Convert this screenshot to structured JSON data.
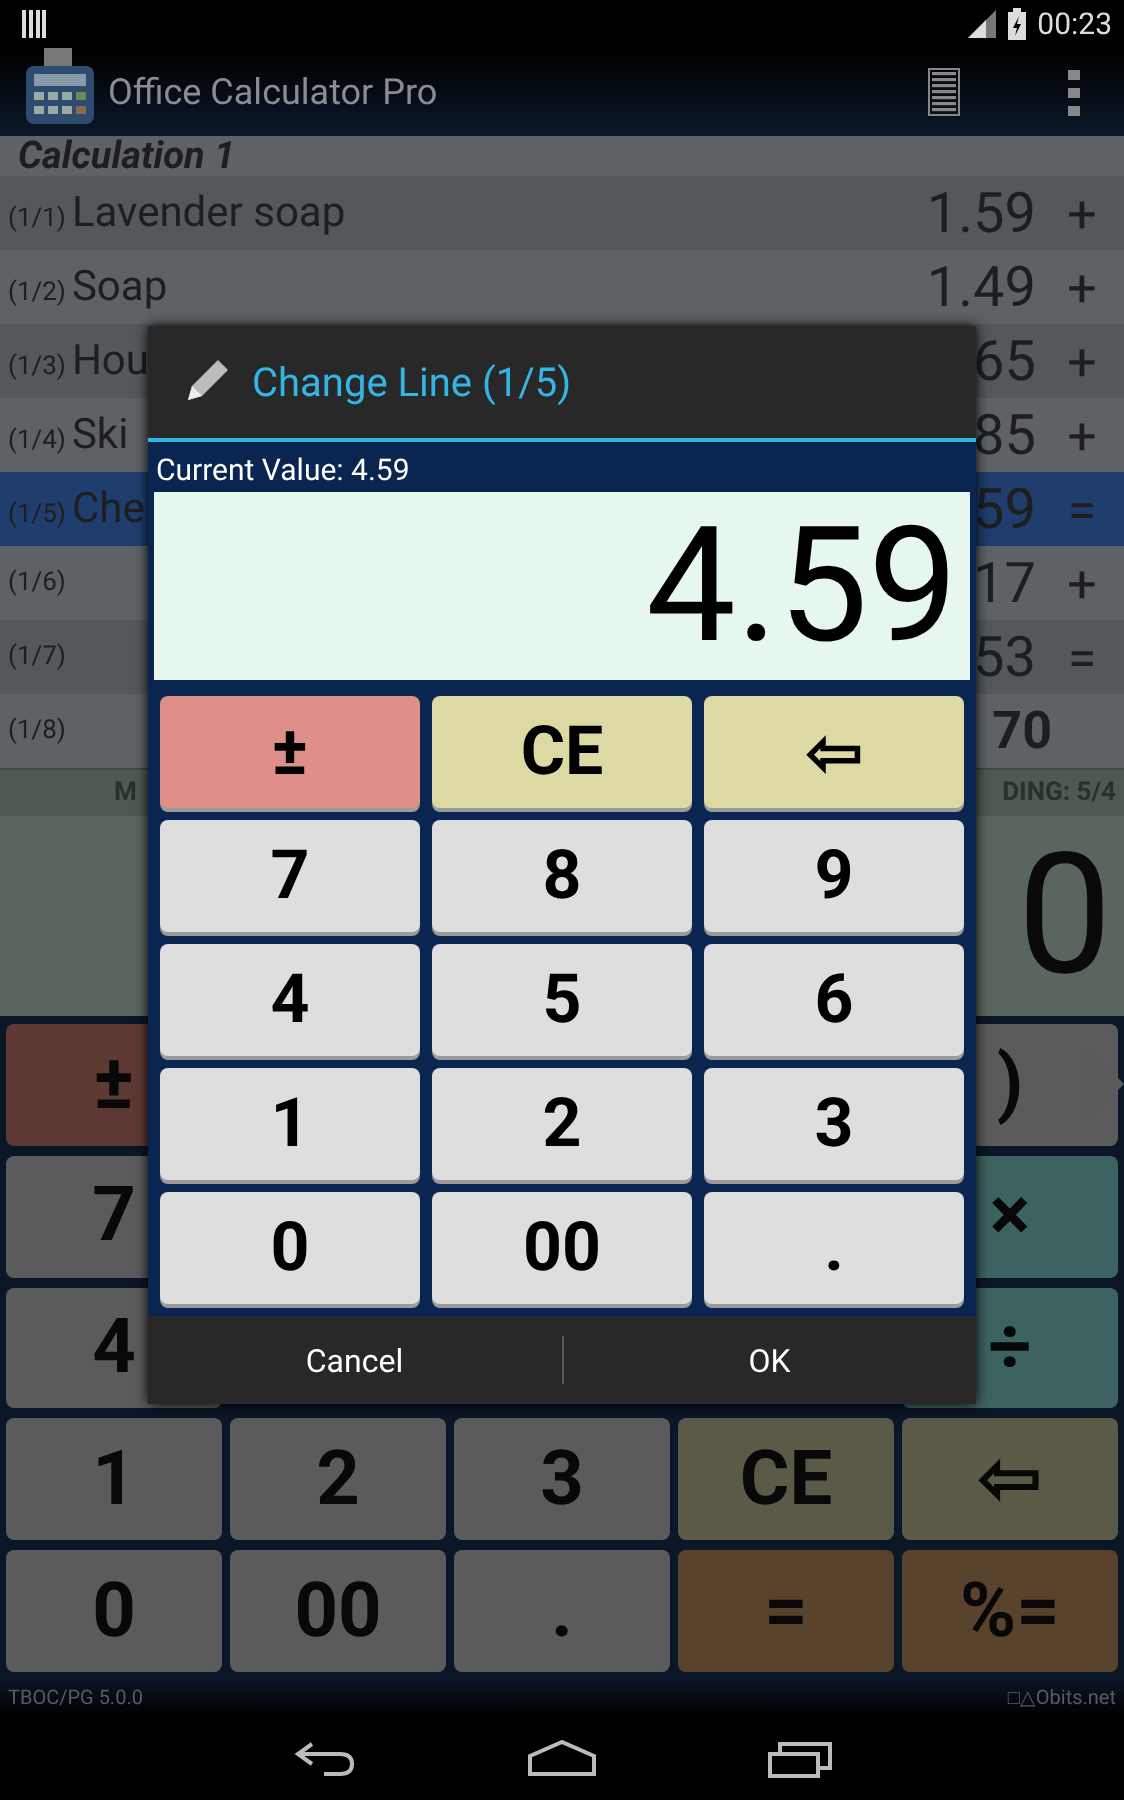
{
  "status_bar": {
    "time": "00:23"
  },
  "action_bar": {
    "title": "Office Calculator Pro"
  },
  "calculation": {
    "title": "Calculation 1",
    "lines": [
      {
        "index": "(1/1)",
        "name": "Lavender soap",
        "value": "1.59",
        "operator": "+",
        "selected": false
      },
      {
        "index": "(1/2)",
        "name": "Soap",
        "value": "1.49",
        "operator": "+",
        "selected": false
      },
      {
        "index": "(1/3)",
        "name": "Hou",
        "value": "65",
        "operator": "+",
        "selected": false
      },
      {
        "index": "(1/4)",
        "name": "Ski",
        "value": "85",
        "operator": "+",
        "selected": false
      },
      {
        "index": "(1/5)",
        "name": "Che",
        "value": "59",
        "operator": "=",
        "selected": true
      },
      {
        "index": "(1/6)",
        "value": "17",
        "operator": "+",
        "selected": false
      },
      {
        "index": "(1/7)",
        "value": "53",
        "operator": "=",
        "selected": false
      },
      {
        "index": "(1/8)",
        "value": "70",
        "kind": "total",
        "selected": false
      }
    ]
  },
  "memory_line": {
    "left": "M",
    "right": "DING: 5/4"
  },
  "display": {
    "value": "0"
  },
  "keypad": {
    "rows": [
      {
        "left": [
          {
            "label": "±",
            "kind": "sign"
          }
        ],
        "right": [
          {
            "label": ")",
            "kind": "plain"
          }
        ]
      },
      {
        "left": [
          {
            "label": "7",
            "kind": "digit"
          }
        ],
        "right": [
          {
            "label": "×",
            "kind": "op"
          }
        ]
      },
      {
        "left": [
          {
            "label": "4",
            "kind": "digit"
          }
        ],
        "right": [
          {
            "label": "÷",
            "kind": "op"
          }
        ]
      },
      {
        "left": [
          {
            "label": "1",
            "kind": "digit"
          },
          {
            "label": "2",
            "kind": "digit"
          },
          {
            "label": "3",
            "kind": "digit"
          },
          {
            "label": "CE",
            "kind": "edit"
          },
          {
            "label": "⇦",
            "kind": "edit"
          }
        ]
      },
      {
        "left": [
          {
            "label": "0",
            "kind": "digit"
          },
          {
            "label": "00",
            "kind": "digit"
          },
          {
            "label": ".",
            "kind": "digit"
          },
          {
            "label": "=",
            "kind": "equals"
          },
          {
            "label": "%=",
            "kind": "equals"
          }
        ]
      }
    ]
  },
  "footer": {
    "version": "TBOC/PG 5.0.0",
    "brand": "□△Obits.net"
  },
  "dialog": {
    "title": "Change Line (1/5)",
    "current_label": "Current Value: 4.59",
    "value": "4.59",
    "keys": [
      {
        "label": "±",
        "kind": "sign"
      },
      {
        "label": "CE",
        "kind": "edit"
      },
      {
        "label": "⇦",
        "kind": "edit"
      },
      {
        "label": "7",
        "kind": "digit"
      },
      {
        "label": "8",
        "kind": "digit"
      },
      {
        "label": "9",
        "kind": "digit"
      },
      {
        "label": "4",
        "kind": "digit"
      },
      {
        "label": "5",
        "kind": "digit"
      },
      {
        "label": "6",
        "kind": "digit"
      },
      {
        "label": "1",
        "kind": "digit"
      },
      {
        "label": "2",
        "kind": "digit"
      },
      {
        "label": "3",
        "kind": "digit"
      },
      {
        "label": "0",
        "kind": "digit"
      },
      {
        "label": "00",
        "kind": "digit"
      },
      {
        "label": ".",
        "kind": "digit"
      }
    ],
    "buttons": [
      "Cancel",
      "OK"
    ]
  }
}
